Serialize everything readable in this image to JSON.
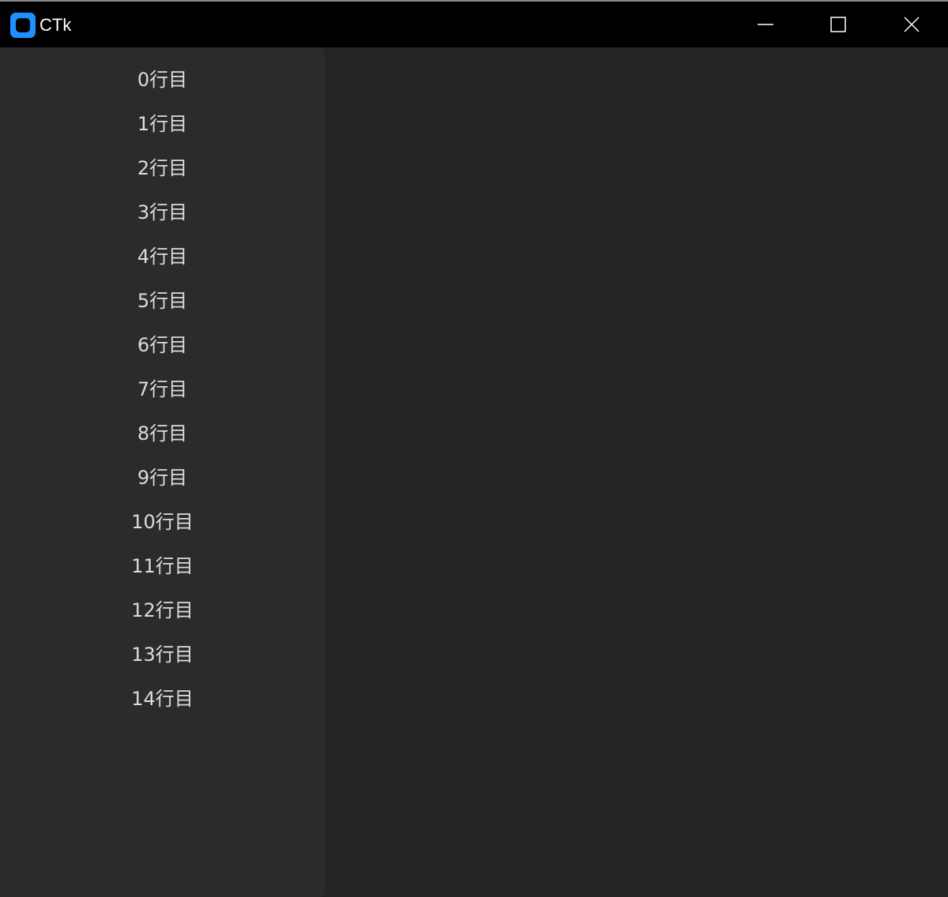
{
  "window": {
    "title": "CTk",
    "icon": "ctk-app-icon",
    "controls": {
      "minimize_icon": "minimize-icon",
      "maximize_icon": "maximize-icon",
      "close_icon": "close-icon"
    }
  },
  "sidebar": {
    "rows": [
      "0行目",
      "1行目",
      "2行目",
      "3行目",
      "4行目",
      "5行目",
      "6行目",
      "7行目",
      "8行目",
      "9行目",
      "10行目",
      "11行目",
      "12行目",
      "13行目",
      "14行目"
    ]
  },
  "colors": {
    "accent": "#1e90ff",
    "titlebar": "#000000",
    "background": "#242424",
    "frame": "#2b2b2b",
    "text": "#dcdcdc"
  }
}
